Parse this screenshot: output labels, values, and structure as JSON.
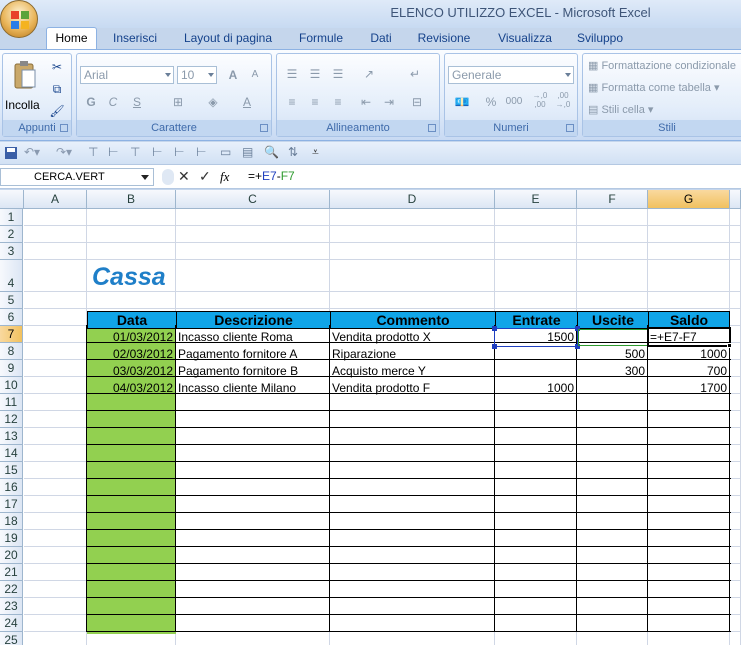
{
  "window": {
    "title": "ELENCO UTILIZZO EXCEL - Microsoft Excel"
  },
  "tabs": [
    "Home",
    "Inserisci",
    "Layout di pagina",
    "Formule",
    "Dati",
    "Revisione",
    "Visualizza",
    "Sviluppo"
  ],
  "ribbon": {
    "groups": {
      "clipboard": "Appunti",
      "font": "Carattere",
      "alignment": "Allineamento",
      "number": "Numeri",
      "styles": "Stili"
    },
    "paste_label": "Incolla",
    "font_name": "Arial",
    "font_size": "10",
    "bold": "G",
    "italic": "C",
    "underline": "S",
    "grow_font": "A",
    "shrink_font": "A",
    "font_color": "A",
    "number_format": "Generale",
    "percent": "%",
    "thousands": "000",
    "increase_decimals": "→,0 ,00",
    "decrease_decimals": ",00 →,0",
    "conditional_formatting": "Formattazione condizionale",
    "format_as_table": "Formatta come tabella",
    "cell_styles": "Stili cella"
  },
  "formula_bar": {
    "name_box": "CERCA.VERT",
    "fx": "fx",
    "formula_prefix": "=+",
    "formula_ref1": "E7",
    "formula_op": "-",
    "formula_ref2": "F7"
  },
  "sheet": {
    "columns": [
      "A",
      "B",
      "C",
      "D",
      "E",
      "F",
      "G"
    ],
    "rows": [
      "1",
      "2",
      "3",
      "4",
      "5",
      "6",
      "7",
      "8",
      "9",
      "10",
      "11",
      "12",
      "13",
      "14",
      "15",
      "16",
      "17",
      "18",
      "19",
      "20",
      "21",
      "22",
      "23",
      "24",
      "25"
    ],
    "title": "Cassa",
    "table_headers": [
      "Data",
      "Descrizione",
      "Commento",
      "Entrate",
      "Uscite",
      "Saldo"
    ],
    "table_rows": [
      {
        "data": "01/03/2012",
        "descrizione": "Incasso cliente Roma",
        "commento": "Vendita prodotto X",
        "entrate": "1500",
        "uscite": "",
        "saldo": "=+E7-F7"
      },
      {
        "data": "02/03/2012",
        "descrizione": "Pagamento fornitore A",
        "commento": "Riparazione",
        "entrate": "",
        "uscite": "500",
        "saldo": "1000"
      },
      {
        "data": "03/03/2012",
        "descrizione": "Pagamento fornitore B",
        "commento": "Acquisto merce Y",
        "entrate": "",
        "uscite": "300",
        "saldo": "700"
      },
      {
        "data": "04/03/2012",
        "descrizione": "Incasso cliente Milano",
        "commento": "Vendita prodotto F",
        "entrate": "1000",
        "uscite": "",
        "saldo": "1700"
      }
    ],
    "active_cell": "G7",
    "colors": {
      "header_fill": "#10a5e8",
      "date_fill": "#92d050",
      "title_color": "#1f7fc8",
      "ref_blue": "#1f3fbf",
      "ref_green": "#2e9a2e"
    }
  }
}
